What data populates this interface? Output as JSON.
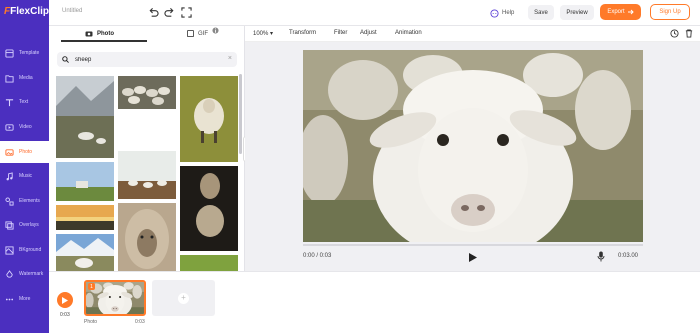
{
  "app": {
    "name": "FlexClip",
    "doc_title": "Untitled"
  },
  "sidebar": {
    "items": [
      {
        "label": "Template",
        "icon": "template-icon"
      },
      {
        "label": "Media",
        "icon": "media-icon"
      },
      {
        "label": "Text",
        "icon": "text-icon"
      },
      {
        "label": "Video",
        "icon": "video-icon"
      },
      {
        "label": "Photo",
        "icon": "photo-icon",
        "active": true
      },
      {
        "label": "Music",
        "icon": "music-icon"
      },
      {
        "label": "Elements",
        "icon": "elements-icon"
      },
      {
        "label": "Overlays",
        "icon": "overlays-icon"
      },
      {
        "label": "BKground",
        "icon": "background-icon"
      },
      {
        "label": "Watermark",
        "icon": "watermark-icon"
      },
      {
        "label": "More",
        "icon": "more-icon"
      }
    ]
  },
  "topbar": {
    "help": "Help",
    "save": "Save",
    "preview": "Preview",
    "export": "Export",
    "signup": "Sign Up"
  },
  "panel": {
    "tabs": {
      "photo": "Photo",
      "gif": "GIF"
    },
    "search": {
      "value": "sheep",
      "placeholder": "Search photos"
    }
  },
  "canvas_toolbar": {
    "zoom": "100%",
    "transform": "Transform",
    "filter": "Filter",
    "adjust": "Adjust",
    "animation": "Animation"
  },
  "player": {
    "current_time": "0:00 / 0:03",
    "duration": "0:03.00",
    "progress": 0
  },
  "timeline": {
    "time": "0:03",
    "clip_number": "1",
    "clip_label": "Photo",
    "clip_duration": "0:03"
  },
  "colors": {
    "sidebar": "#4b2fbf",
    "accent": "#ff7a29",
    "stage": "#f0f0f3"
  }
}
